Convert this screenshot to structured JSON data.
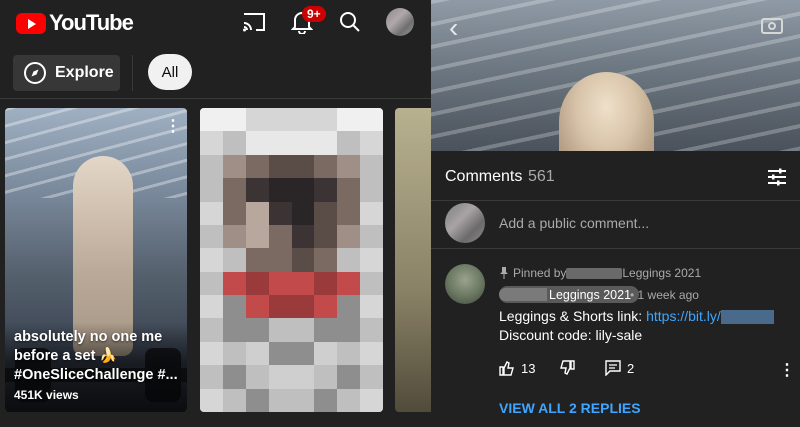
{
  "header": {
    "logo_text": "YouTube",
    "notification_badge": "9+"
  },
  "chips": {
    "explore_label": "Explore",
    "all_label": "All"
  },
  "shorts": [
    {
      "title_line1": "absolutely no one  me",
      "title_line2": "before a set  🍌",
      "title_line3": "#OneSliceChallenge #...",
      "views": "451K views"
    }
  ],
  "comments_panel": {
    "title": "Comments",
    "count": "561",
    "add_placeholder": "Add a public comment...",
    "comment": {
      "pinned_prefix": "Pinned by",
      "pinned_author_suffix": "Leggings 2021",
      "author_suffix": "Leggings 2021",
      "time": "1 week ago",
      "line1_text": "Leggings & Shorts link: ",
      "line1_link": "https://bit.ly/",
      "line2_text": "Discount code: lily-sale",
      "likes": "13",
      "replies_count": "2",
      "view_replies_label": "VIEW ALL 2 REPLIES"
    }
  },
  "colors": {
    "accent_red": "#ff0000",
    "link_blue": "#3ea6ff",
    "background": "#212121"
  }
}
